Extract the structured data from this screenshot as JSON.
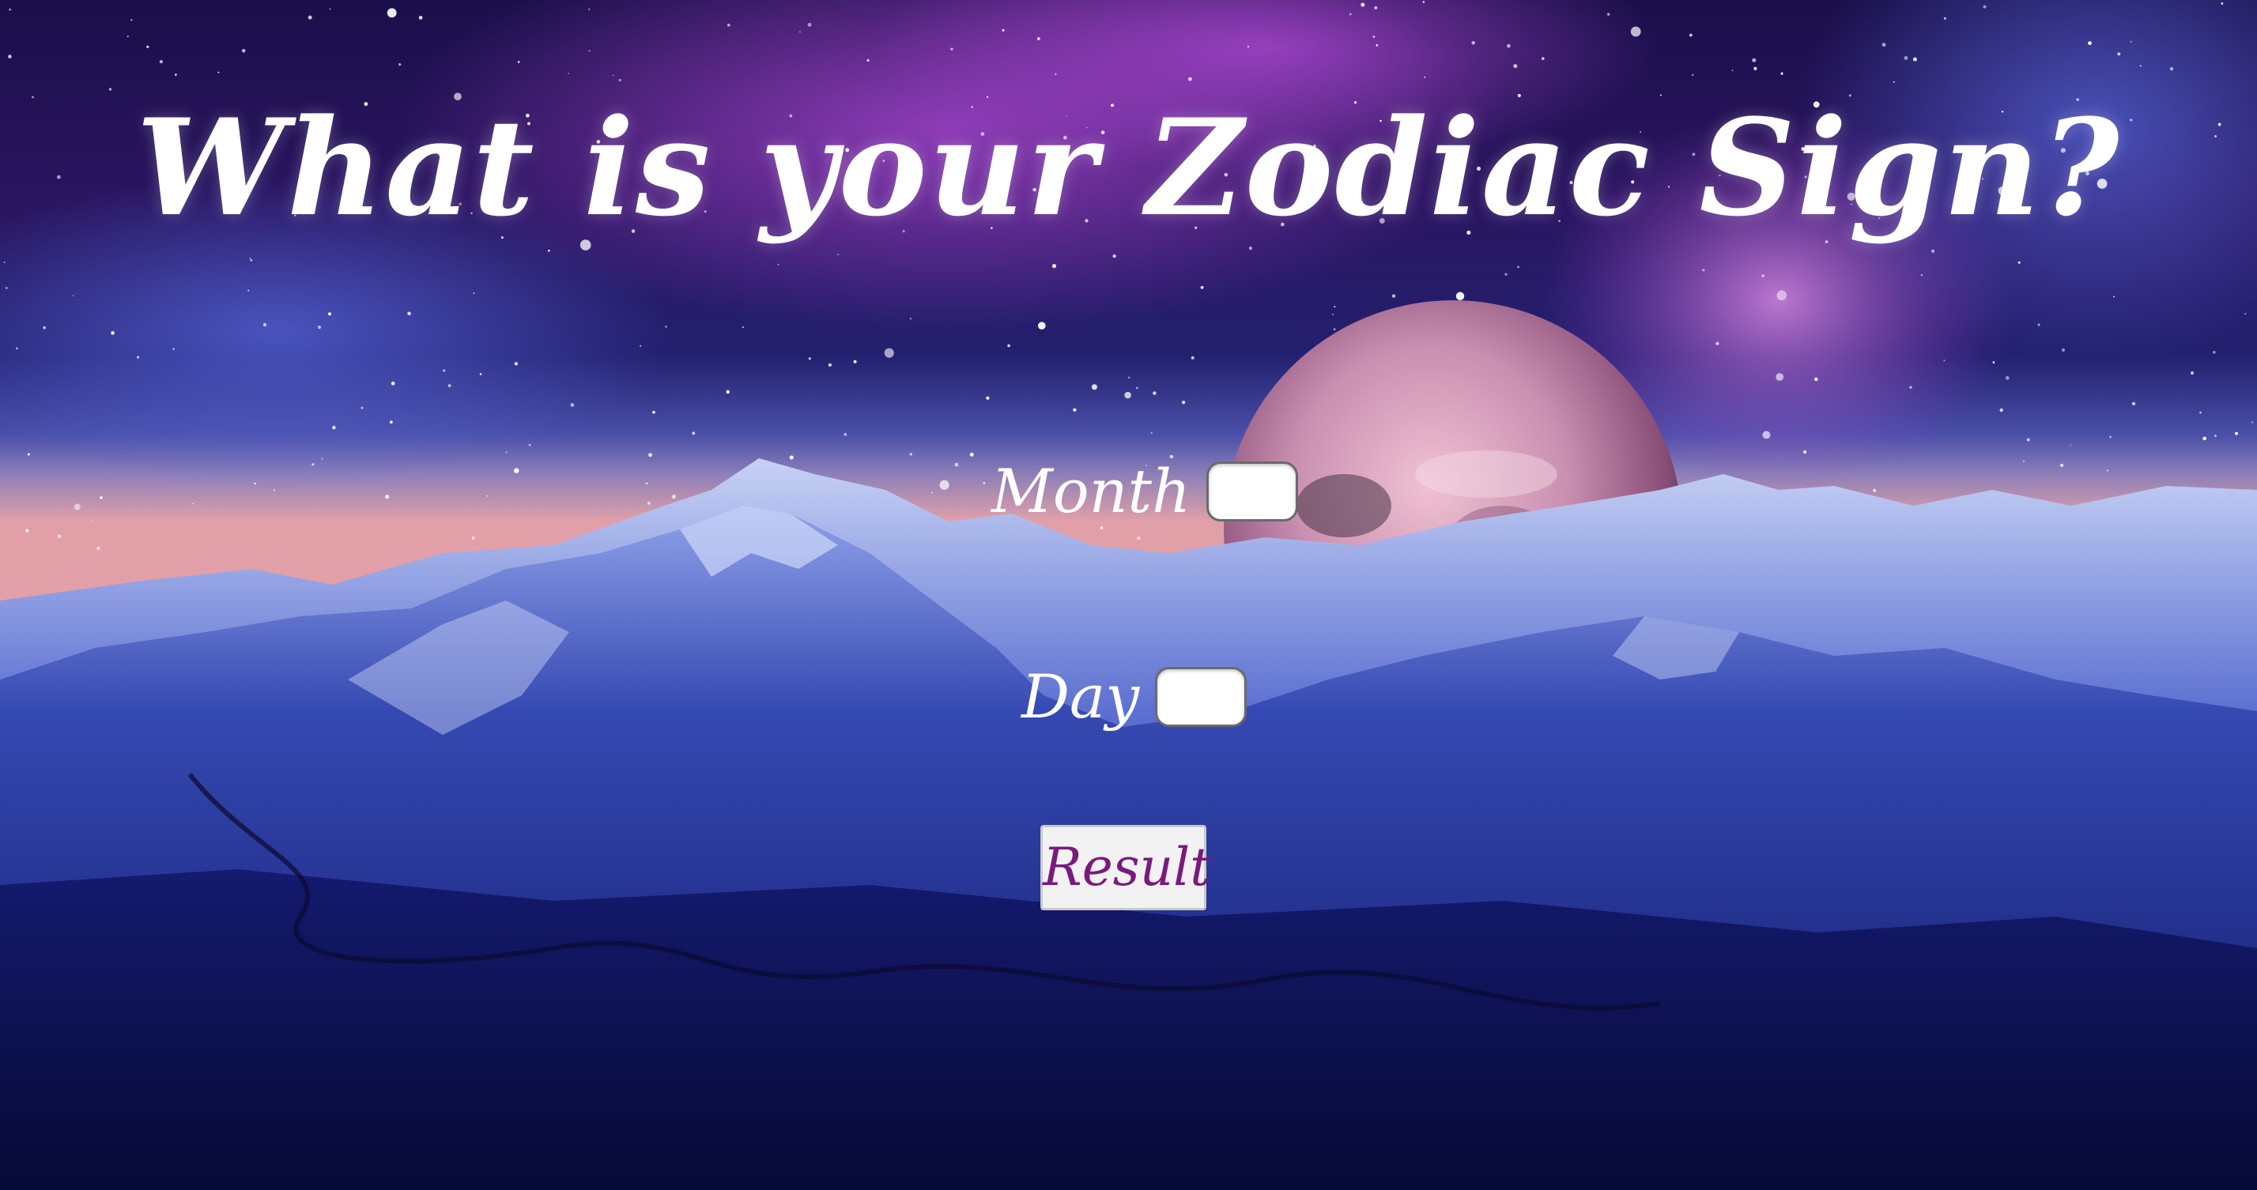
{
  "page": {
    "title": "What is your Zodiac Sign?"
  },
  "form": {
    "month_label": "Month",
    "month_value": "",
    "day_label": "Day",
    "day_value": "",
    "result_label": "Result"
  },
  "colors": {
    "title_text": "#ffffff",
    "button_text": "#7a1a7e",
    "sky_top": "#1a1150",
    "nebula_purple": "#8a3fc2",
    "mountain_blue": "#2a3fa8",
    "planet_pink": "#c98fb0"
  },
  "background": {
    "description_icon": "starry-sky-mountain-planet-background"
  }
}
